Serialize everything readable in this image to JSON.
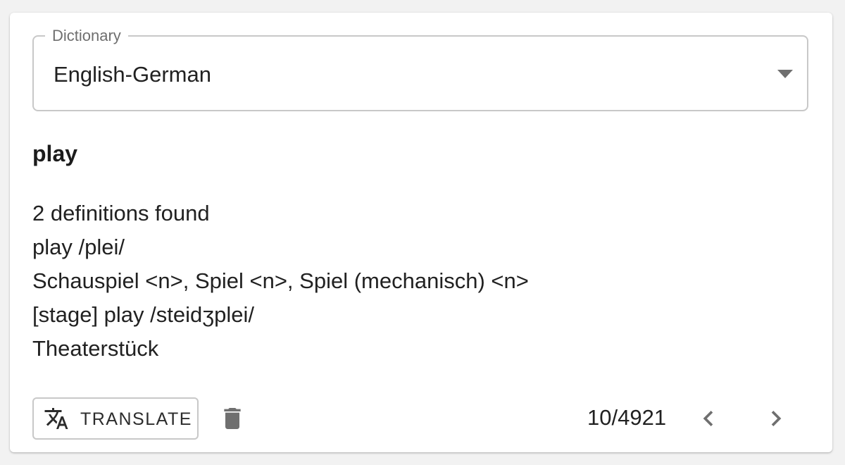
{
  "dictionary": {
    "label": "Dictionary",
    "selected": "English-German"
  },
  "entry": {
    "word": "play",
    "definition_lines": [
      "2 definitions found",
      "play /plei/",
      "Schauspiel <n>, Spiel <n>, Spiel (mechanisch) <n>",
      "[stage] play /steidʒplei/",
      "Theaterstück"
    ]
  },
  "actions": {
    "translate_label": "TRANSLATE",
    "translate_icon": "translate-icon",
    "delete_icon": "delete-icon"
  },
  "pagination": {
    "position": "10/4921",
    "prev_icon": "chevron-left-icon",
    "next_icon": "chevron-right-icon"
  },
  "colors": {
    "background": "#f2f2f2",
    "card": "#ffffff",
    "border": "#c8c8c8",
    "icon": "#6f6f6f",
    "text": "#212121"
  }
}
